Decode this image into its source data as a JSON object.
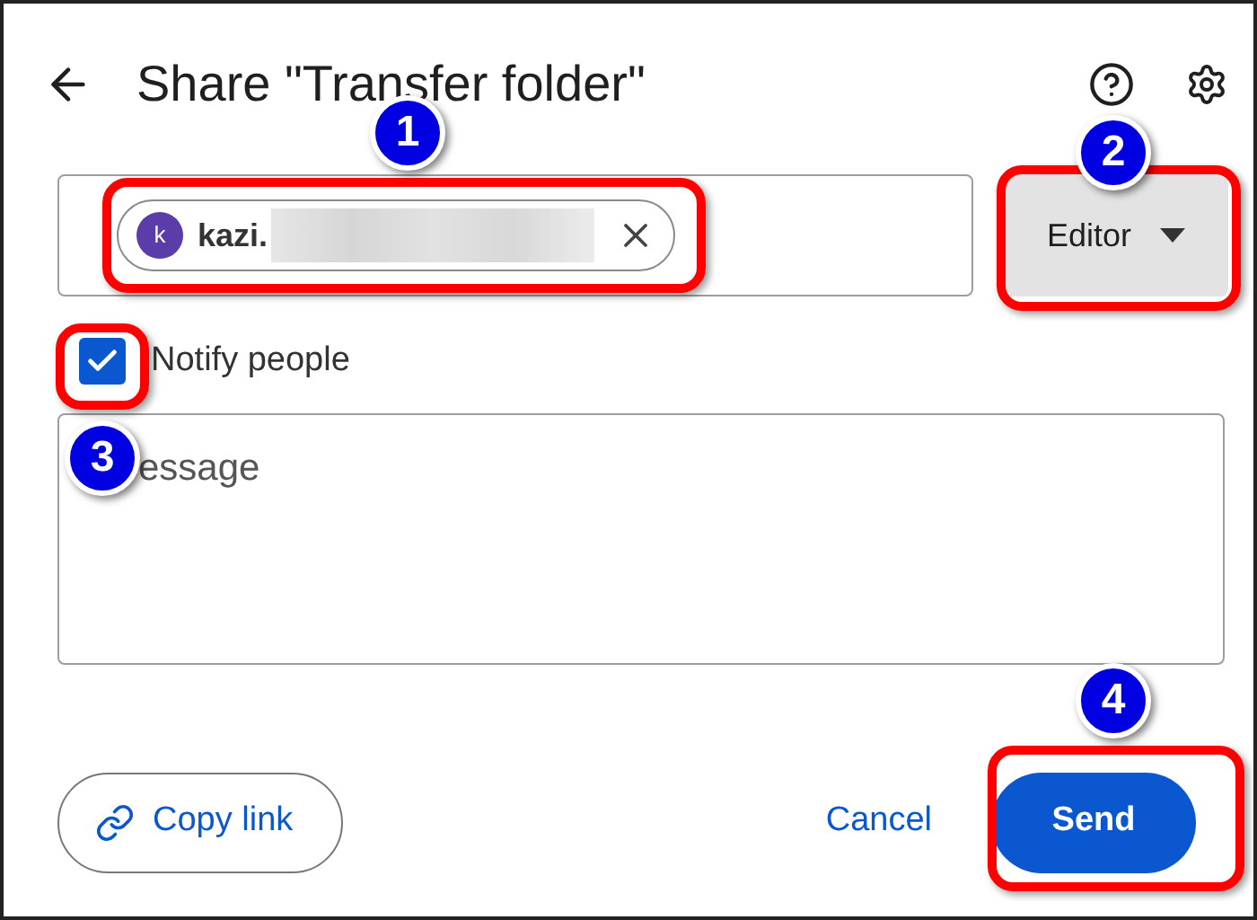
{
  "dialog": {
    "title": "Share \"Transfer folder\""
  },
  "recipient": {
    "avatar_letter": "k",
    "name": "kazi."
  },
  "role_dropdown": {
    "value": "Editor"
  },
  "notify": {
    "label": "Notify people",
    "checked": true
  },
  "message": {
    "placeholder": "essage"
  },
  "buttons": {
    "copy_link": "Copy link",
    "cancel": "Cancel",
    "send": "Send"
  },
  "markers": [
    {
      "number": "1"
    },
    {
      "number": "2"
    },
    {
      "number": "3"
    },
    {
      "number": "4"
    }
  ]
}
